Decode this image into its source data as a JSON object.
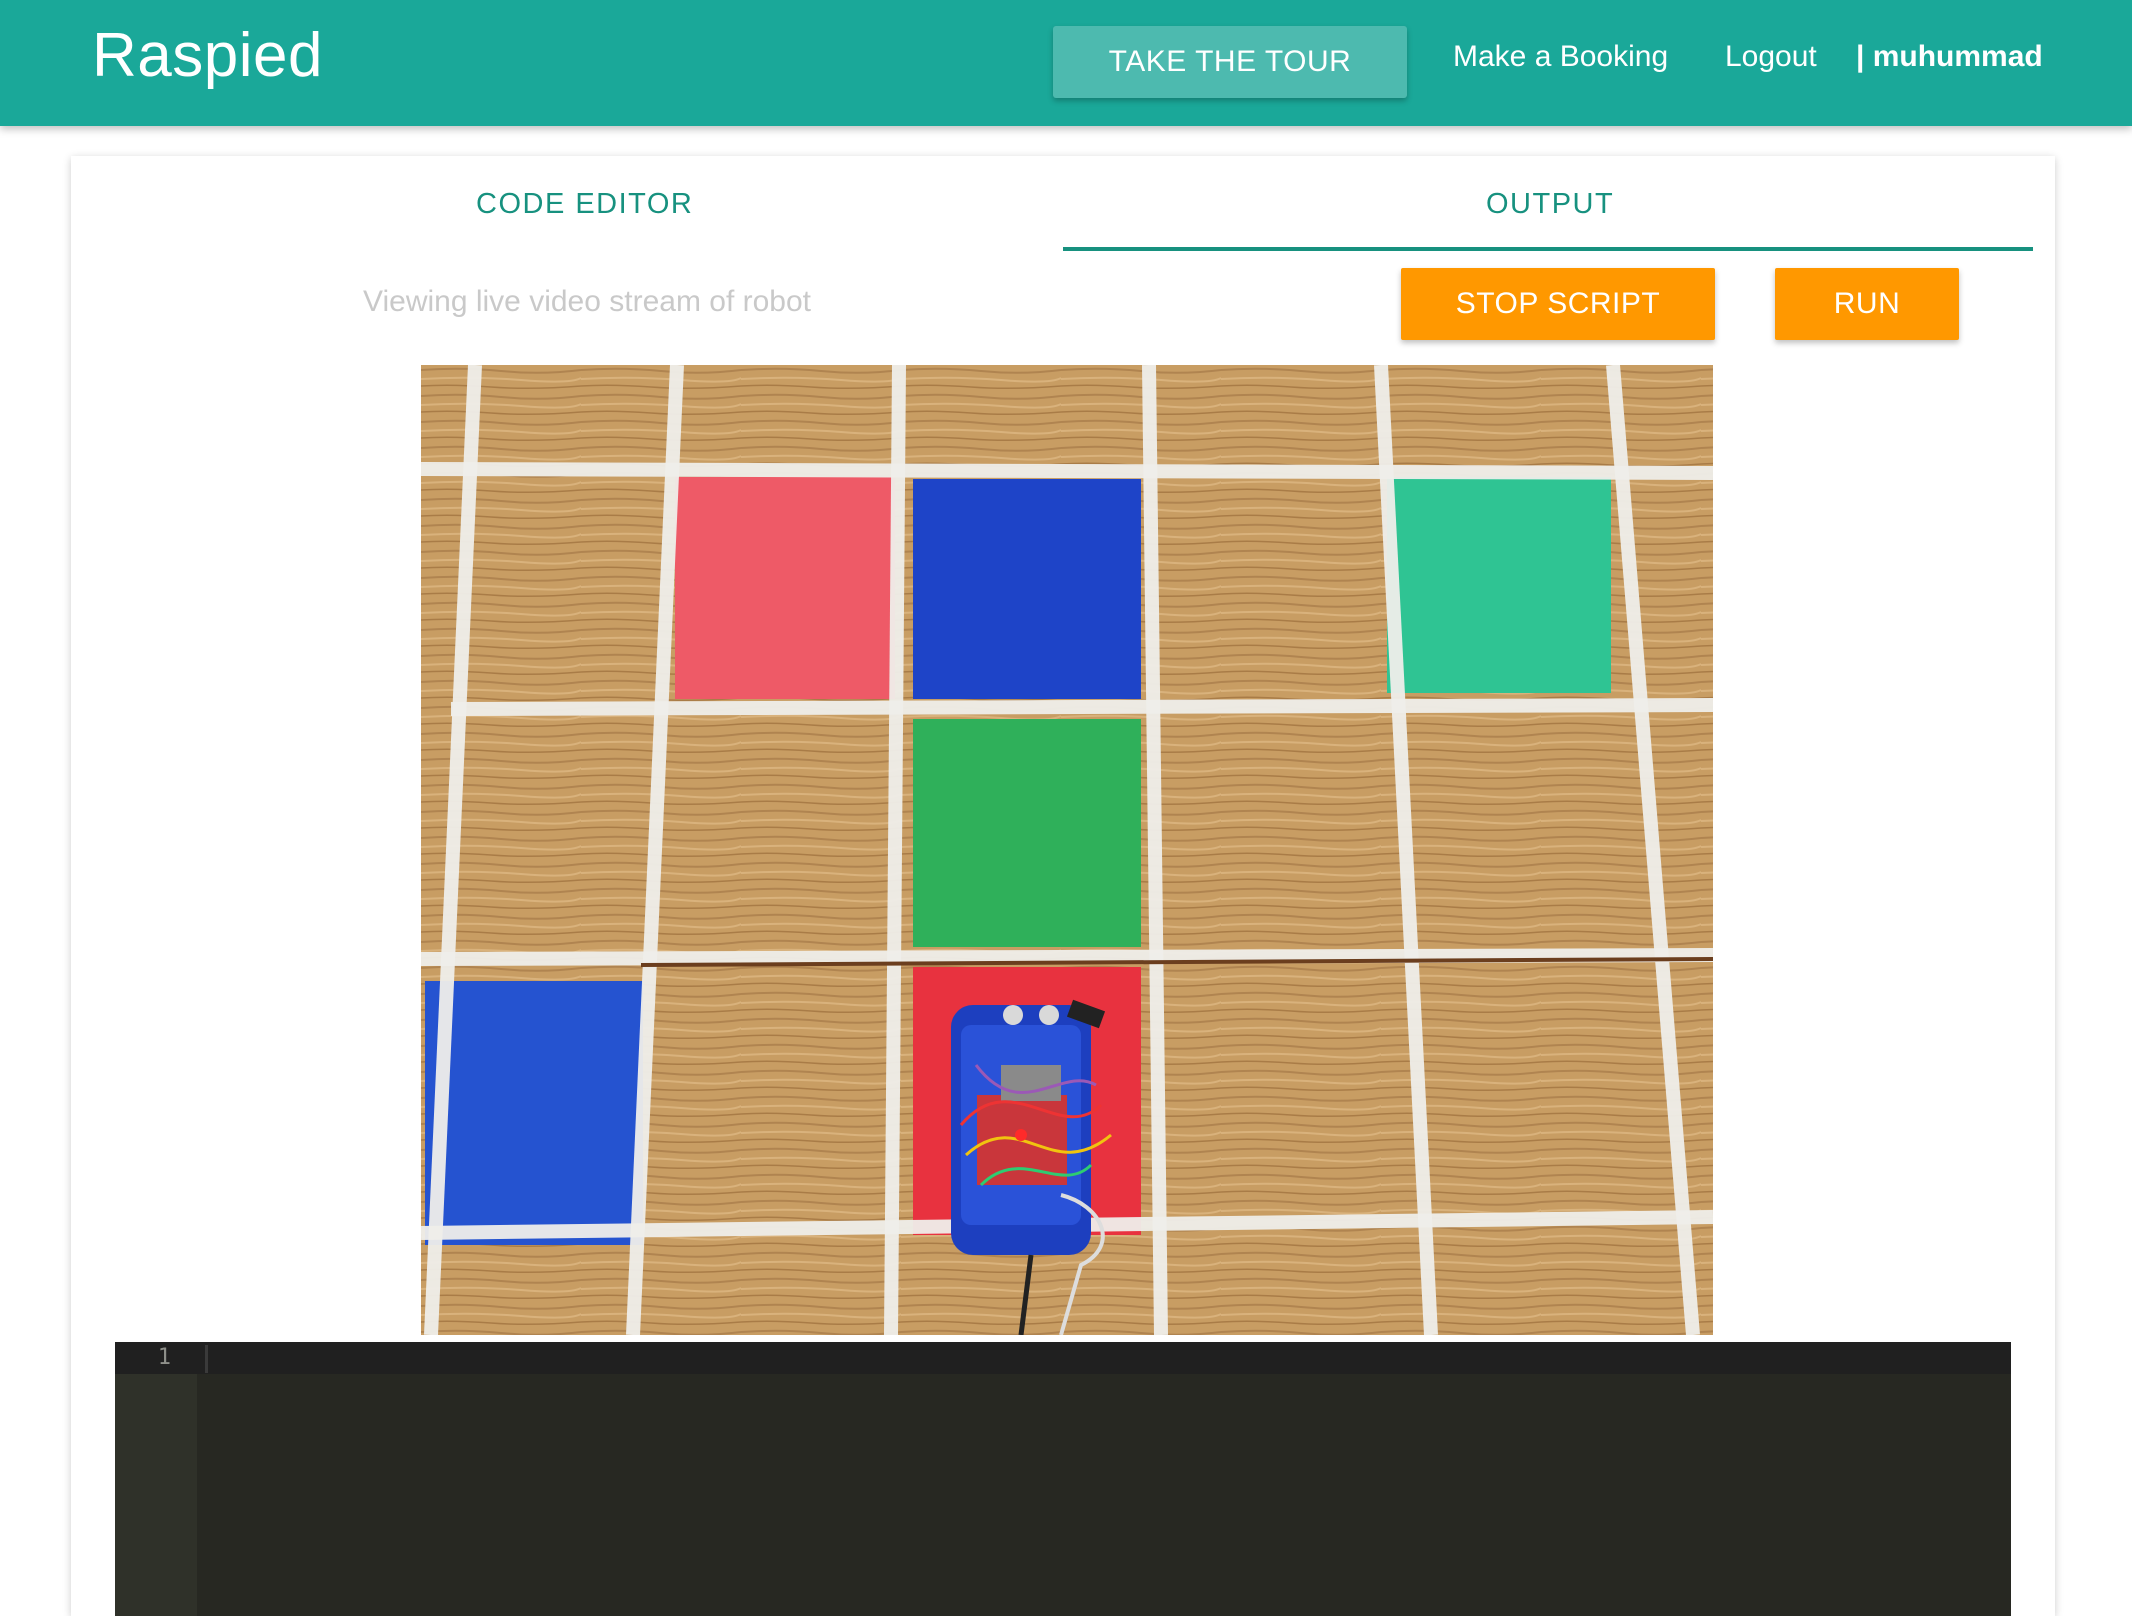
{
  "app": {
    "brand": "Raspied"
  },
  "nav": {
    "tour_label": "TAKE THE TOUR",
    "booking_label": "Make a Booking",
    "logout_label": "Logout",
    "user_label": "| muhummad"
  },
  "tabs": [
    {
      "label": "CODE EDITOR",
      "active": false
    },
    {
      "label": "OUTPUT",
      "active": true
    }
  ],
  "output": {
    "hint": "Viewing live video stream of robot",
    "stop_label": "STOP SCRIPT",
    "run_label": "RUN"
  },
  "editor": {
    "line_numbers": [
      "1"
    ]
  },
  "colors": {
    "navbar": "#1aa899",
    "tab_accent": "#17917f",
    "action_button": "#ff9800",
    "editor_bg": "#272822"
  }
}
